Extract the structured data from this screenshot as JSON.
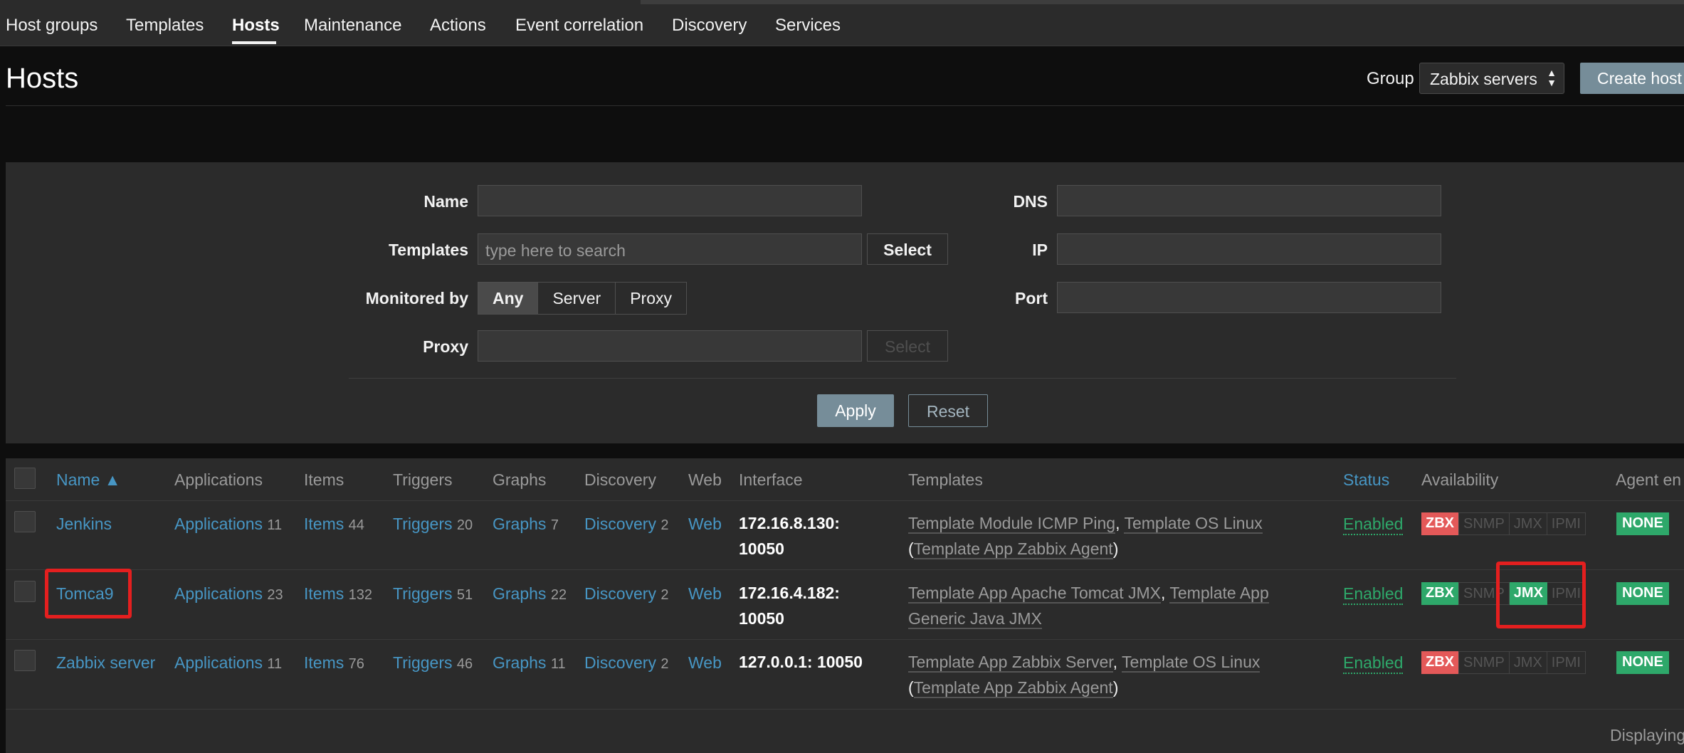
{
  "nav": {
    "tabs": [
      "Host groups",
      "Templates",
      "Hosts",
      "Maintenance",
      "Actions",
      "Event correlation",
      "Discovery",
      "Services"
    ],
    "active": "Hosts"
  },
  "header": {
    "title": "Hosts",
    "group_label": "Group",
    "group_value": "Zabbix servers",
    "create_button": "Create host"
  },
  "filter": {
    "name_label": "Name",
    "name_value": "",
    "templates_label": "Templates",
    "templates_placeholder": "type here to search",
    "templates_select": "Select",
    "monitored_label": "Monitored by",
    "monitored_options": [
      "Any",
      "Server",
      "Proxy"
    ],
    "monitored_selected": "Any",
    "proxy_label": "Proxy",
    "proxy_select": "Select",
    "dns_label": "DNS",
    "ip_label": "IP",
    "port_label": "Port",
    "apply": "Apply",
    "reset": "Reset"
  },
  "table": {
    "columns": {
      "name": "Name ▲",
      "applications": "Applications",
      "items": "Items",
      "triggers": "Triggers",
      "graphs": "Graphs",
      "discovery": "Discovery",
      "web": "Web",
      "interface": "Interface",
      "templates": "Templates",
      "status": "Status",
      "availability": "Availability",
      "agent_encryption": "Agent en"
    },
    "rows": [
      {
        "name": "Jenkins",
        "applications": "Applications",
        "applications_count": "11",
        "items": "Items",
        "items_count": "44",
        "triggers": "Triggers",
        "triggers_count": "20",
        "graphs": "Graphs",
        "graphs_count": "7",
        "discovery": "Discovery",
        "discovery_count": "2",
        "web": "Web",
        "interface_line1": "172.16.8.130:",
        "interface_line2": "10050",
        "tpl1": "Template Module ICMP Ping",
        "sep1": ", ",
        "tpl2": "Template OS Linux",
        "open": "(",
        "tpl3": "Template App Zabbix Agent",
        "close": ")",
        "status": "Enabled",
        "zbx": "ZBX",
        "snmp": "SNMP",
        "jmx": "JMX",
        "ipmi": "IPMI",
        "encryption": "NONE"
      },
      {
        "name": "Tomca9",
        "applications": "Applications",
        "applications_count": "23",
        "items": "Items",
        "items_count": "132",
        "triggers": "Triggers",
        "triggers_count": "51",
        "graphs": "Graphs",
        "graphs_count": "22",
        "discovery": "Discovery",
        "discovery_count": "2",
        "web": "Web",
        "interface_line1": "172.16.4.182:",
        "interface_line2": "10050",
        "tpl1": "Template App Apache Tomcat JMX",
        "sep1": ", ",
        "tpl2": "Template App",
        "tpl2b": "Generic Java JMX",
        "status": "Enabled",
        "zbx": "ZBX",
        "snmp": "SNMP",
        "jmx": "JMX",
        "ipmi": "IPMI",
        "encryption": "NONE"
      },
      {
        "name": "Zabbix server",
        "applications": "Applications",
        "applications_count": "11",
        "items": "Items",
        "items_count": "76",
        "triggers": "Triggers",
        "triggers_count": "46",
        "graphs": "Graphs",
        "graphs_count": "11",
        "discovery": "Discovery",
        "discovery_count": "2",
        "web": "Web",
        "interface_line1": "127.0.0.1: 10050",
        "tpl1": "Template App Zabbix Server",
        "sep1": ", ",
        "tpl2": "Template OS Linux",
        "open": "(",
        "tpl3": "Template App Zabbix Agent",
        "close": ")",
        "status": "Enabled",
        "zbx": "ZBX",
        "snmp": "SNMP",
        "jmx": "JMX",
        "ipmi": "IPMI",
        "encryption": "NONE"
      }
    ]
  },
  "footer": {
    "text": "Displaying"
  },
  "colors": {
    "link": "#4796c4",
    "enabled": "#2ea86a",
    "zbx_down": "#e45959",
    "highlight": "#e41f1f",
    "button": "#768d99"
  }
}
